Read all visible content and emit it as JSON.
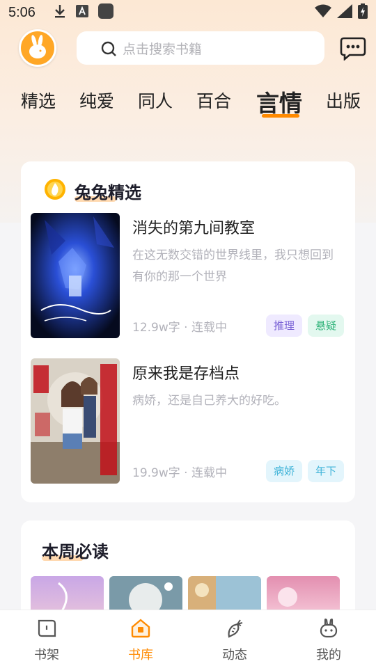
{
  "status_bar": {
    "time": "5:06"
  },
  "header": {
    "search_placeholder": "点击搜索书籍"
  },
  "tabs": [
    {
      "label": "精选"
    },
    {
      "label": "纯爱"
    },
    {
      "label": "同人"
    },
    {
      "label": "百合"
    },
    {
      "label": "言情",
      "active": true
    },
    {
      "label": "出版"
    }
  ],
  "featured": {
    "title": "兔兔精选",
    "books": [
      {
        "title": "消失的第九间教室",
        "desc": "在这无数交错的世界线里，我只想回到有你的那一个世界",
        "meta": "12.9w字 · 连载中",
        "tags": [
          "推理",
          "悬疑"
        ]
      },
      {
        "title": "原来我是存档点",
        "desc": "病娇，还是自己养大的好吃。",
        "meta": "19.9w字 · 连载中",
        "tags": [
          "病娇",
          "年下"
        ]
      }
    ]
  },
  "weekly": {
    "title": "本周必读"
  },
  "bottom_nav": [
    {
      "label": "书架",
      "icon": "bookshelf-icon"
    },
    {
      "label": "书库",
      "icon": "library-icon",
      "active": true
    },
    {
      "label": "动态",
      "icon": "carrot-icon"
    },
    {
      "label": "我的",
      "icon": "bunny-icon"
    }
  ],
  "colors": {
    "accent": "#ff8a00"
  }
}
